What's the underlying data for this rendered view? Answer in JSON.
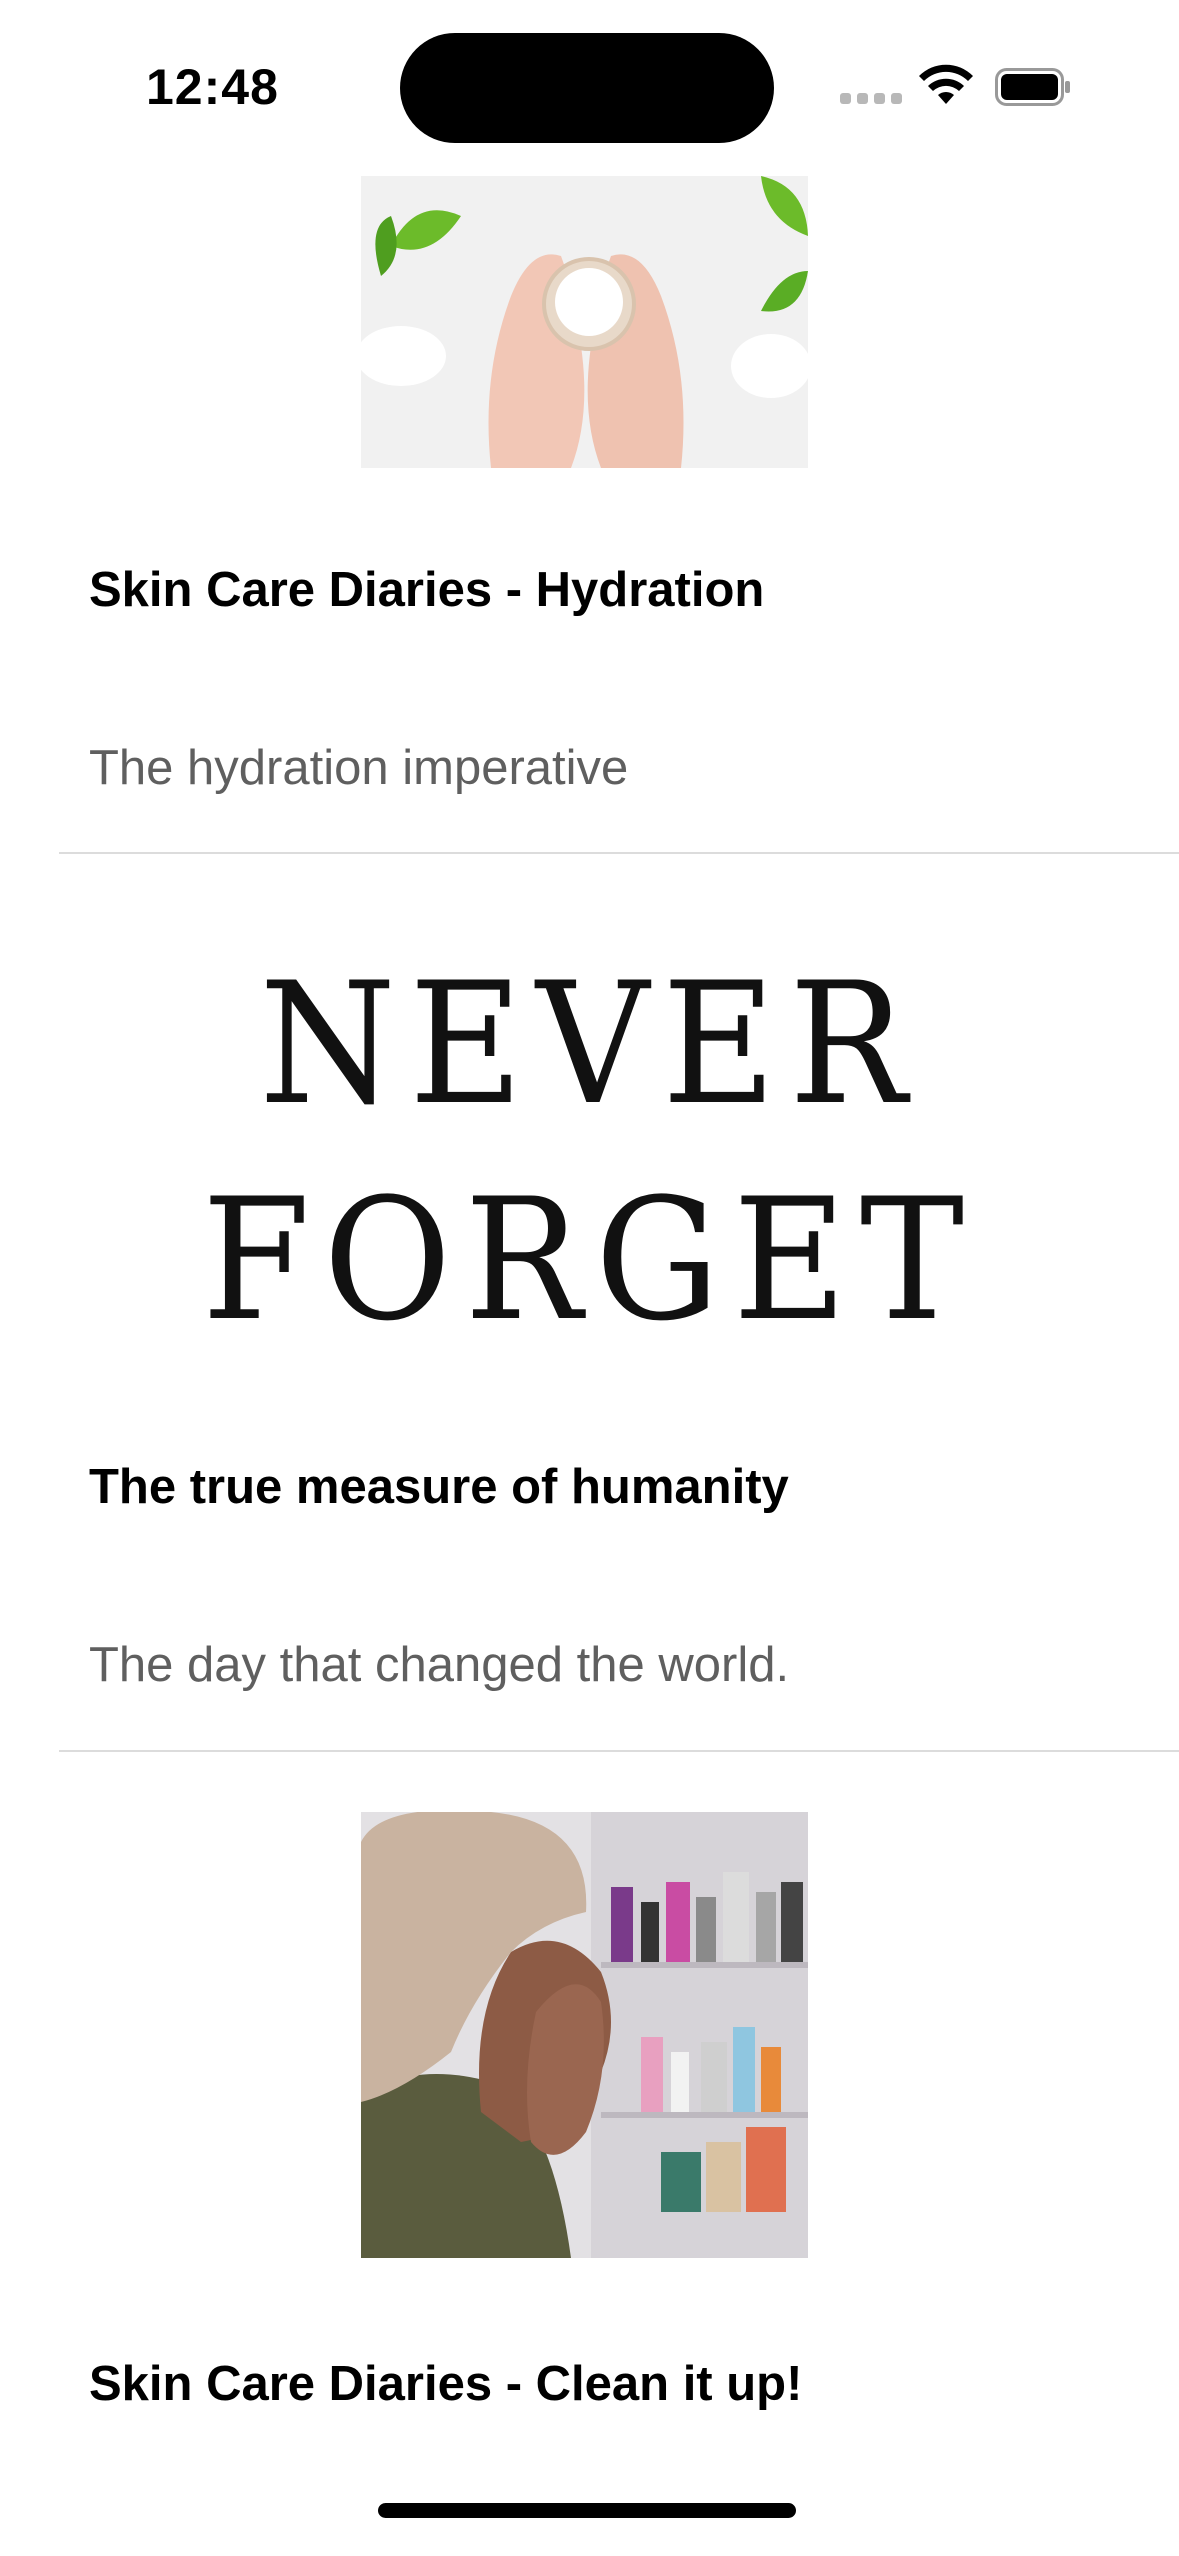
{
  "status_bar": {
    "time": "12:48"
  },
  "feed": {
    "items": [
      {
        "title": "Skin Care Diaries - Hydration",
        "subtitle": "The hydration imperative",
        "image": "hands-holding-cream-jar-photo"
      },
      {
        "title": "The true measure of humanity",
        "subtitle": "The day that changed the world.",
        "image": "never-forget-text-image",
        "image_text": [
          "NEVER",
          "FORGET"
        ]
      },
      {
        "title": "Skin Care Diaries - Clean it up!",
        "image": "woman-with-towel-washing-face-photo"
      }
    ]
  },
  "colors": {
    "title": "#000000",
    "subtitle": "#5f5f5f",
    "divider": "#dcdcdc"
  }
}
